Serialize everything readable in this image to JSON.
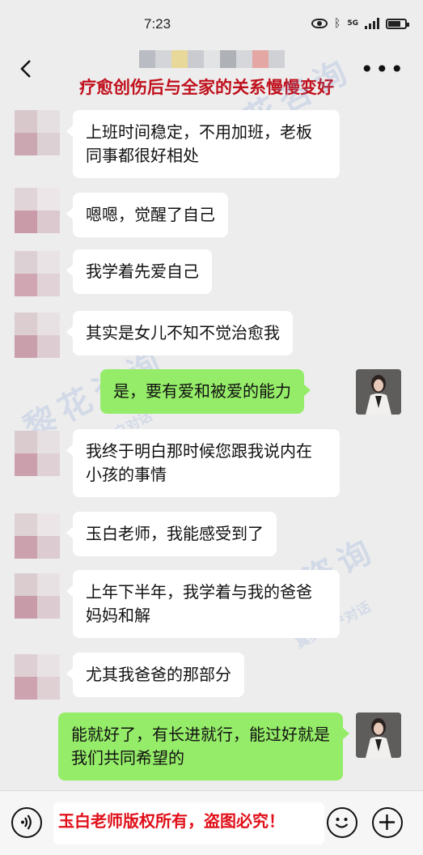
{
  "status_bar": {
    "time": "7:23",
    "network": "5G"
  },
  "header": {
    "overlay_title": "疗愈创伤后与全家的关系慢慢变好"
  },
  "watermarks": {
    "brand": "黎花咨询",
    "tag": "真实客户对话"
  },
  "messages": [
    {
      "side": "left",
      "text": "上班时间稳定，不用加班，老板同事都很好相处"
    },
    {
      "side": "left",
      "text": "嗯嗯，觉醒了自己"
    },
    {
      "side": "left",
      "text": "我学着先爱自己"
    },
    {
      "side": "left",
      "text": "其实是女儿不知不觉治愈我"
    },
    {
      "side": "right",
      "text": "是，要有爱和被爱的能力"
    },
    {
      "side": "left",
      "text": "我终于明白那时候您跟我说内在小孩的事情"
    },
    {
      "side": "left",
      "text": "玉白老师，我能感受到了"
    },
    {
      "side": "left",
      "text": "上年下半年，我学着与我的爸爸妈妈和解"
    },
    {
      "side": "left",
      "text": "尤其我爸爸的那部分"
    },
    {
      "side": "right",
      "text": "能就好了，有长进就行，能过好就是我们共同希望的"
    }
  ],
  "input_bar": {
    "copyright_notice": "玉白老师版权所有，盗图必究！"
  },
  "icons": {
    "back": "chevron-left-icon",
    "more": "more-icon",
    "voice": "voice-icon",
    "emoji": "emoji-icon",
    "add": "plus-icon"
  },
  "colors": {
    "own_bubble": "#95ec69",
    "other_bubble": "#ffffff",
    "background": "#ededed",
    "overlay_red": "#c0101c"
  }
}
